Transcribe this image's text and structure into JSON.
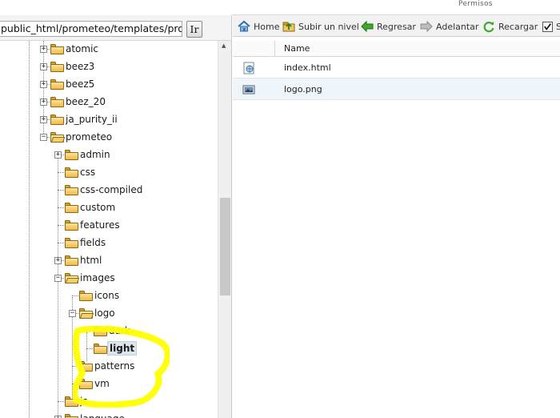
{
  "header": {
    "permisos_label": "Permisos"
  },
  "path_bar": {
    "path_value": "public_html/prometeo/templates/prometeo",
    "go_label": "Ir"
  },
  "tree": {
    "nodes": [
      {
        "label": "atomic",
        "expander": "+"
      },
      {
        "label": "beez3",
        "expander": "+"
      },
      {
        "label": "beez5",
        "expander": "+"
      },
      {
        "label": "beez_20",
        "expander": "+"
      },
      {
        "label": "ja_purity_ii",
        "expander": "+"
      },
      {
        "label": "prometeo",
        "expander": "−"
      },
      {
        "label": "admin",
        "expander": "+"
      },
      {
        "label": "css"
      },
      {
        "label": "css-compiled"
      },
      {
        "label": "custom"
      },
      {
        "label": "features"
      },
      {
        "label": "fields"
      },
      {
        "label": "html",
        "expander": "+"
      },
      {
        "label": "images",
        "expander": "−"
      },
      {
        "label": "icons"
      },
      {
        "label": "logo",
        "expander": "−"
      },
      {
        "label": "dark"
      },
      {
        "label": "light",
        "selected": true
      },
      {
        "label": "patterns"
      },
      {
        "label": "vm"
      },
      {
        "label": "js"
      },
      {
        "label": "language",
        "expander": "+"
      }
    ]
  },
  "toolbar": {
    "home_label": "Home",
    "up_label": "Subir un nivel",
    "back_label": "Regresar",
    "forward_label": "Adelantar",
    "reload_label": "Recargar",
    "checkbox_label": "S"
  },
  "file_table": {
    "column_name": "Name",
    "rows": [
      {
        "name": "index.html",
        "icon": "html-file-icon"
      },
      {
        "name": "logo.png",
        "icon": "image-file-icon"
      }
    ]
  },
  "colors": {
    "highlight": "#ffff00",
    "folder": "#f1b94a",
    "selected_bg": "#dce6ec",
    "row_alt": "#eef6fc"
  }
}
